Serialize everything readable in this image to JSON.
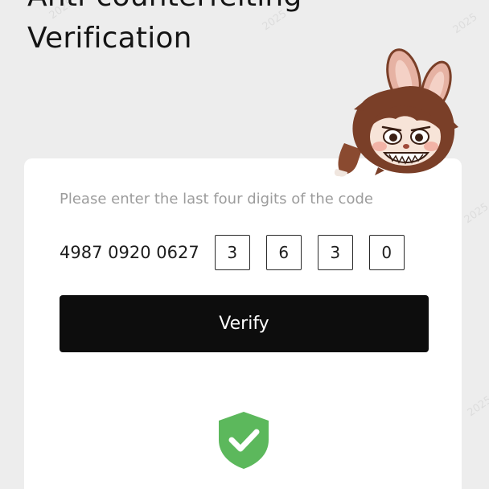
{
  "page": {
    "title_line1": "Anti-counterfeiting",
    "title_line2": "Verification",
    "watermark_text": "2025"
  },
  "form": {
    "instruction": "Please enter the last four digits of the code",
    "code_prefix": "4987 0920 0627",
    "digits": [
      "3",
      "6",
      "3",
      "0"
    ],
    "verify_label": "Verify"
  },
  "status": {
    "icon": "shield-check-icon",
    "color": "#5cb85c"
  },
  "colors": {
    "button": "#0d0d0d",
    "mascot_fur": "#7a3f28",
    "mascot_ears": "#e8b4a6"
  }
}
